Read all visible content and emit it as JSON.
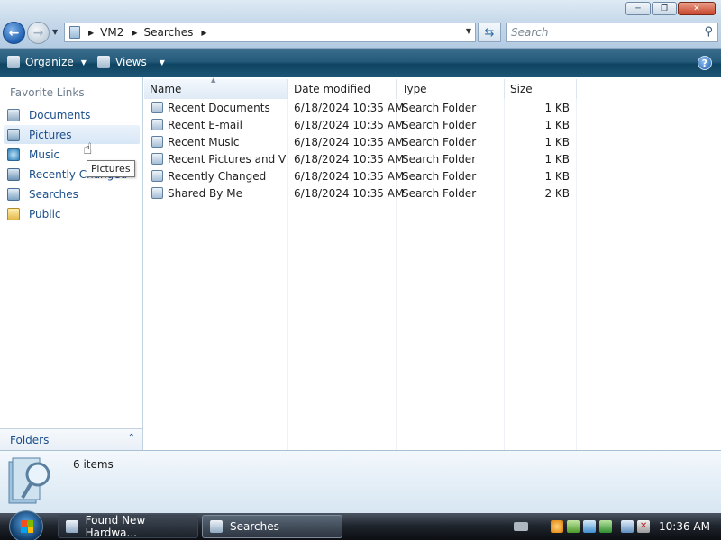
{
  "address": {
    "crumbs": [
      "VM2",
      "Searches"
    ]
  },
  "search": {
    "placeholder": "Search"
  },
  "toolbar": {
    "organize_label": "Organize",
    "views_label": "Views",
    "help_label": "?"
  },
  "nav": {
    "header": "Favorite Links",
    "links": [
      {
        "label": "Documents",
        "icon": "documents-icon"
      },
      {
        "label": "Pictures",
        "icon": "pictures-icon"
      },
      {
        "label": "Music",
        "icon": "music-icon"
      },
      {
        "label": "Recently Changed",
        "icon": "recently-changed-icon"
      },
      {
        "label": "Searches",
        "icon": "searches-icon"
      },
      {
        "label": "Public",
        "icon": "public-folder-icon"
      }
    ],
    "folders_label": "Folders",
    "tooltip": "Pictures"
  },
  "filelist": {
    "columns": [
      "Name",
      "Date modified",
      "Type",
      "Size"
    ],
    "rows": [
      {
        "name": "Recent Documents",
        "date": "6/18/2024 10:35 AM",
        "type": "Search Folder",
        "size": "1 KB"
      },
      {
        "name": "Recent E-mail",
        "date": "6/18/2024 10:35 AM",
        "type": "Search Folder",
        "size": "1 KB"
      },
      {
        "name": "Recent Music",
        "date": "6/18/2024 10:35 AM",
        "type": "Search Folder",
        "size": "1 KB"
      },
      {
        "name": "Recent Pictures and Vi...",
        "date": "6/18/2024 10:35 AM",
        "type": "Search Folder",
        "size": "1 KB"
      },
      {
        "name": "Recently Changed",
        "date": "6/18/2024 10:35 AM",
        "type": "Search Folder",
        "size": "1 KB"
      },
      {
        "name": "Shared By Me",
        "date": "6/18/2024 10:35 AM",
        "type": "Search Folder",
        "size": "2 KB"
      }
    ]
  },
  "details": {
    "count": "6 items"
  },
  "taskbar": {
    "buttons": [
      {
        "label": "Found New Hardwa..."
      },
      {
        "label": "Searches"
      }
    ],
    "clock": "10:36 AM"
  },
  "colors": {
    "link_text": "#1d4f8a",
    "command_bar": "#245a7a",
    "selection": "#d8e7f6"
  }
}
